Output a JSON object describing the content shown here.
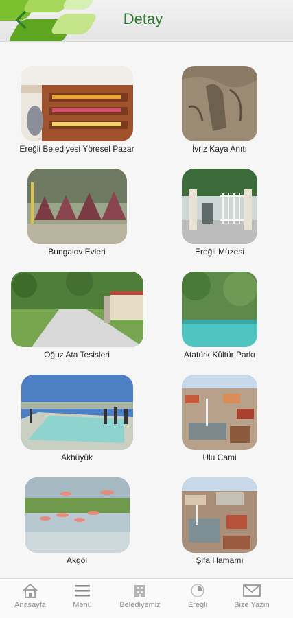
{
  "header": {
    "title": "Detay"
  },
  "places": [
    {
      "name": "Ereğli Belediyesi Yöresel Pazar"
    },
    {
      "name": "İvriz Kaya Anıtı"
    },
    {
      "name": "Bungalov Evleri"
    },
    {
      "name": "Ereğli Müzesi"
    },
    {
      "name": "Oğuz Ata Tesisleri"
    },
    {
      "name": "Atatürk Kültür Parkı"
    },
    {
      "name": "Akhüyük"
    },
    {
      "name": "Ulu Cami"
    },
    {
      "name": "Akgöl"
    },
    {
      "name": "Şifa Hamamı"
    }
  ],
  "tabbar": [
    {
      "label": "Anasayfa",
      "icon": "home-icon"
    },
    {
      "label": "Menü",
      "icon": "menu-icon"
    },
    {
      "label": "Belediyemiz",
      "icon": "building-icon"
    },
    {
      "label": "Ereğli",
      "icon": "emblem-icon"
    },
    {
      "label": "Bize Yazın",
      "icon": "mail-icon"
    }
  ],
  "colors": {
    "accent": "#2e7d32",
    "leaf": "#8dc63f"
  }
}
